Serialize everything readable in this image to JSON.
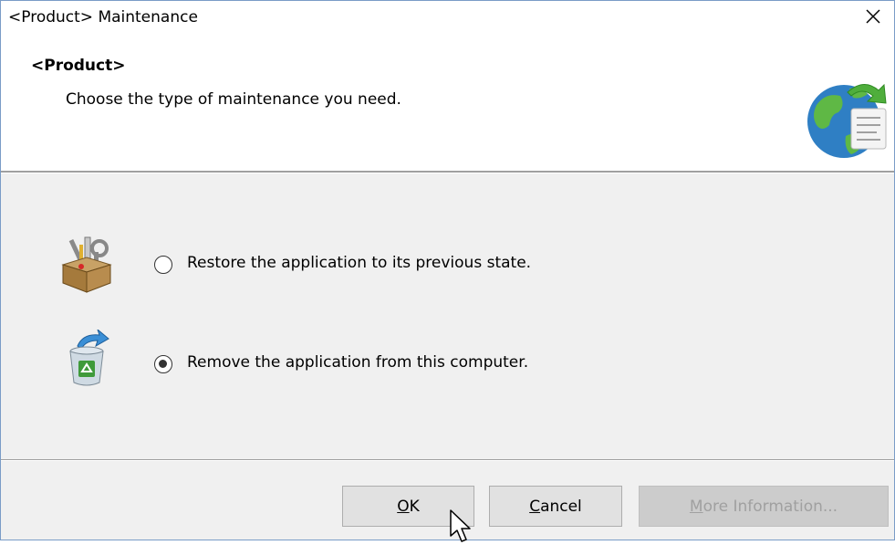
{
  "window": {
    "title": "<Product> Maintenance",
    "close_symbol": "×"
  },
  "header": {
    "title": "<Product>",
    "subtitle": "Choose the type of maintenance you need.",
    "logo_icon": "globe-setup-icon"
  },
  "options": [
    {
      "icon": "toolbox-icon",
      "label": "Restore the application to its previous state.",
      "selected": false
    },
    {
      "icon": "recycle-bin-icon",
      "label": "Remove the application from this computer.",
      "selected": true
    }
  ],
  "buttons": {
    "ok": {
      "accel": "O",
      "rest": "K",
      "enabled": true
    },
    "cancel": {
      "accel": "C",
      "rest": "ancel",
      "enabled": true
    },
    "more_info": {
      "accel": "M",
      "rest": "ore Information...",
      "enabled": false
    }
  },
  "colors": {
    "window_border": "#7a9cc7",
    "panel_bg": "#f0f0f0",
    "button_bg": "#e1e1e1",
    "disabled_text": "#a0a0a0"
  }
}
